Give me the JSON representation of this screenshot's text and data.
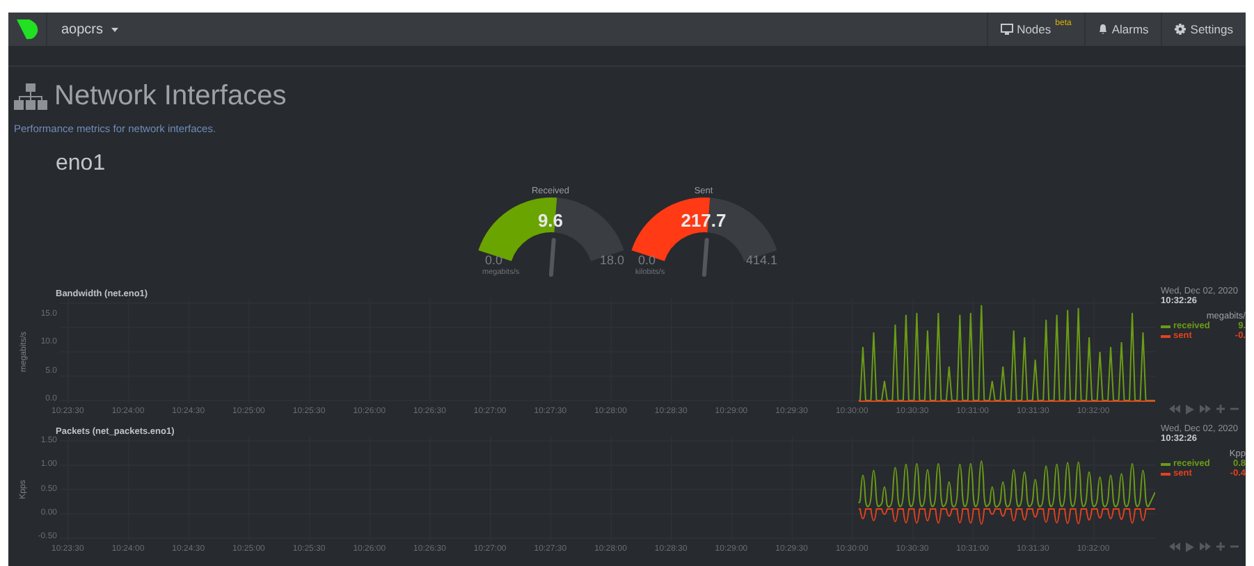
{
  "navbar": {
    "host": "aopcrs",
    "items": [
      {
        "kind": "monitor",
        "label": "Nodes",
        "badge": "beta"
      },
      {
        "kind": "bell",
        "label": "Alarms"
      },
      {
        "kind": "gear",
        "label": "Settings"
      }
    ]
  },
  "page": {
    "title": "Network Interfaces",
    "subtitle": "Performance metrics for network interfaces.",
    "section": "eno1"
  },
  "gauges": [
    {
      "title": "Received",
      "value": "9.6",
      "min": "0.0",
      "max": "18.0",
      "unit": "megabits/s",
      "color": "#6aa400"
    },
    {
      "title": "Sent",
      "value": "217.7",
      "min": "0.0",
      "max": "414.1",
      "unit": "kilobits/s",
      "color": "#ff3a14"
    }
  ],
  "charts": [
    {
      "kind": "unipolar",
      "title": "Bandwidth (net.eno1)",
      "ylabel": "megabits/s",
      "yticks": [
        "15.0",
        "10.0",
        "5.0",
        "0.0"
      ],
      "xticks": [
        "10:23:30",
        "10:24:00",
        "10:24:30",
        "10:25:00",
        "10:25:30",
        "10:26:00",
        "10:26:30",
        "10:27:00",
        "10:27:30",
        "10:28:00",
        "10:28:30",
        "10:29:00",
        "10:29:30",
        "10:30:00",
        "10:30:30",
        "10:31:00",
        "10:31:30",
        "10:32:00"
      ],
      "legend": {
        "date": "Wed, Dec 02, 2020",
        "time": "10:32:26",
        "unit": "megabits/",
        "series": [
          {
            "name": "received",
            "color": "#6b9c15",
            "value": "9."
          },
          {
            "name": "sent",
            "color": "#e3421e",
            "value": "-0."
          }
        ]
      }
    },
    {
      "kind": "bipolar",
      "title": "Packets (net_packets.eno1)",
      "ylabel": "Kpps",
      "yticks": [
        "1.50",
        "1.00",
        "0.50",
        "0.00",
        "-0.50"
      ],
      "xticks": [
        "10:23:30",
        "10:24:00",
        "10:24:30",
        "10:25:00",
        "10:25:30",
        "10:26:00",
        "10:26:30",
        "10:27:00",
        "10:27:30",
        "10:28:00",
        "10:28:30",
        "10:29:00",
        "10:29:30",
        "10:30:00",
        "10:30:30",
        "10:31:00",
        "10:31:30",
        "10:32:00"
      ],
      "legend": {
        "date": "Wed, Dec 02, 2020",
        "time": "10:32:26",
        "unit": "Kpp",
        "series": [
          {
            "name": "received",
            "color": "#6b9c15",
            "value": "0.8"
          },
          {
            "name": "sent",
            "color": "#e3421e",
            "value": "-0.4"
          }
        ]
      }
    }
  ]
}
